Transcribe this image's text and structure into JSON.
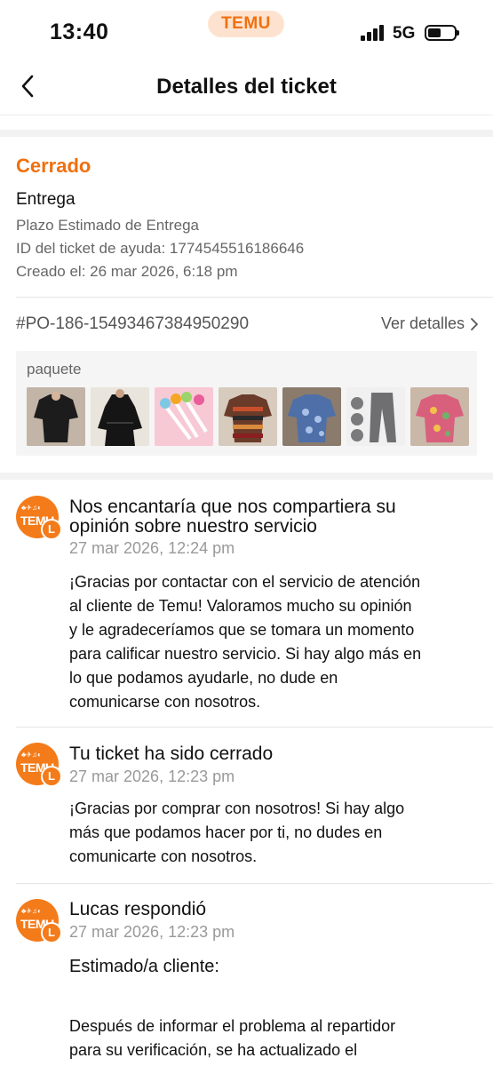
{
  "status_bar": {
    "time": "13:40",
    "app_pill": "TEMU",
    "network": "5G"
  },
  "header": {
    "title": "Detalles del ticket"
  },
  "ticket": {
    "status": "Cerrado",
    "category": "Entrega",
    "subcategory": "Plazo Estimado de Entrega",
    "ticket_id": "ID del ticket de ayuda: 1774545516186646",
    "created": "Creado el: 26 mar 2026, 6:18 pm"
  },
  "order": {
    "id": "#PO-186-15493467384950290",
    "details_link": "Ver detalles",
    "package_label": "paquete",
    "items": [
      {
        "icon": "black-blouse-thumbnail"
      },
      {
        "icon": "black-lace-dress-thumbnail"
      },
      {
        "icon": "colorful-pens-thumbnail"
      },
      {
        "icon": "striped-top-thumbnail"
      },
      {
        "icon": "blue-paisley-shirt-thumbnail"
      },
      {
        "icon": "grey-leggings-thumbnail"
      },
      {
        "icon": "pink-floral-top-thumbnail"
      }
    ]
  },
  "avatar": {
    "brand": "TEMU",
    "initial": "L"
  },
  "messages": [
    {
      "title_line1": "Nos encantaría que nos compartiera su",
      "title_line2": "opinión sobre nuestro servicio",
      "date": "27 mar 2026, 12:24 pm",
      "body": [
        "¡Gracias por contactar con el servicio de atención",
        "al cliente de Temu! Valoramos mucho su opinión",
        "y le agradeceríamos que se tomara un momento",
        "para calificar nuestro servicio. Si hay algo más en",
        "lo que podamos ayudarle, no dude en",
        "comunicarse con nosotros."
      ]
    },
    {
      "title_line1": "Tu ticket ha sido cerrado",
      "date": "27 mar 2026, 12:23 pm",
      "body": [
        "¡Gracias por comprar con nosotros! Si hay algo",
        "más que podamos hacer por ti, no dudes en",
        "comunicarte con nosotros."
      ]
    },
    {
      "title_line1": "Lucas respondió",
      "date": "27 mar 2026, 12:23 pm",
      "greeting": "Estimado/a cliente:",
      "body": [
        "Después de informar el problema al repartidor",
        "para su verificación, se ha actualizado el"
      ]
    }
  ],
  "colors": {
    "accent": "#f0700f",
    "avatar": "#f47b1a"
  }
}
